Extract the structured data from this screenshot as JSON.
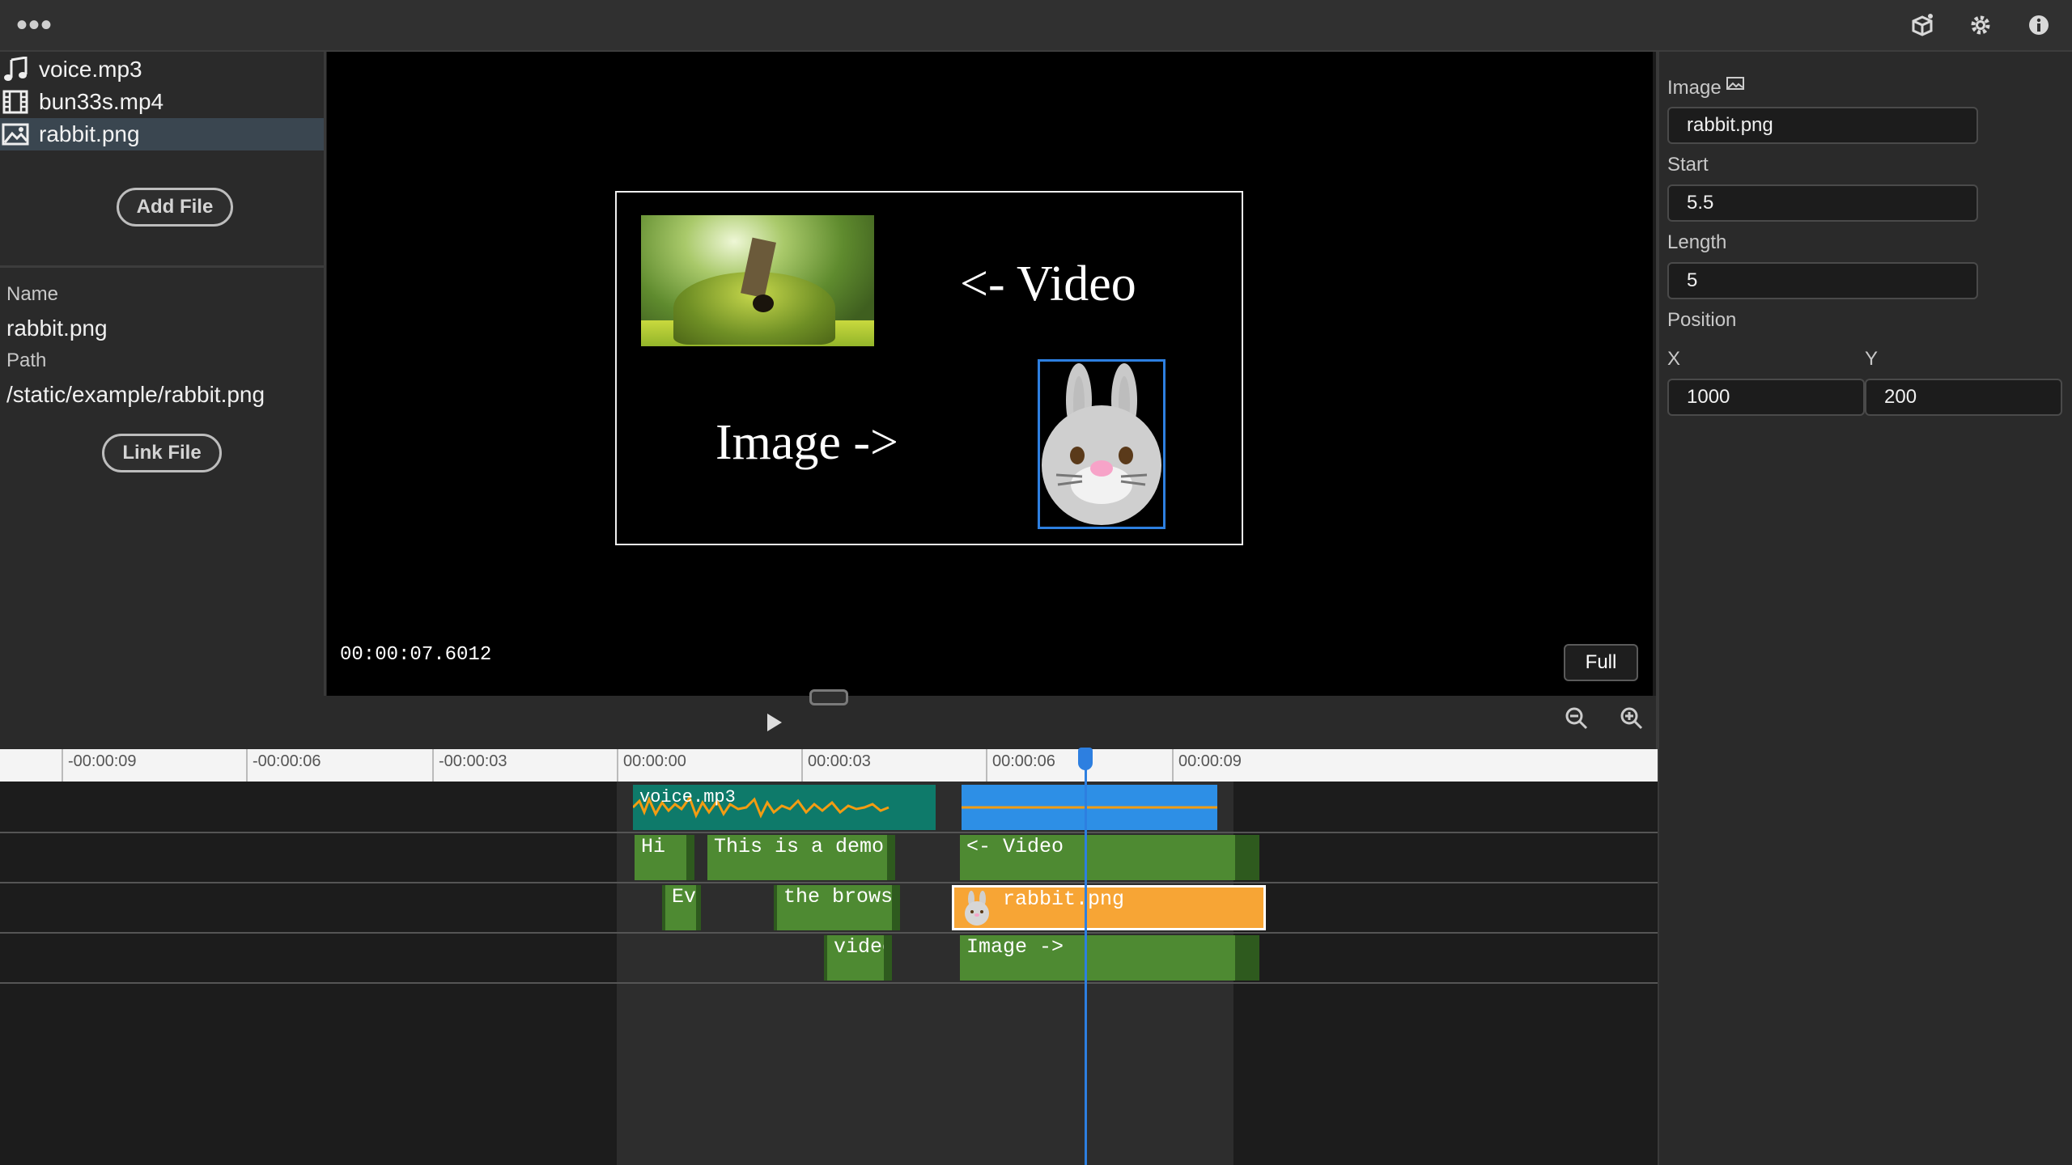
{
  "app": {
    "menu_icon": "more-dots-icon",
    "top_icons": [
      "cube-sparkle-icon",
      "gear-icon",
      "info-icon"
    ]
  },
  "files": [
    {
      "name": "voice.mp3",
      "icon": "music-note-icon"
    },
    {
      "name": "bun33s.mp4",
      "icon": "film-icon"
    },
    {
      "name": "rabbit.png",
      "icon": "image-icon",
      "selected": true
    }
  ],
  "file_actions": {
    "add": "Add File",
    "link": "Link File"
  },
  "selected_file": {
    "name_label": "Name",
    "name": "rabbit.png",
    "path_label": "Path",
    "path": "/static/example/rabbit.png"
  },
  "preview": {
    "video_label": "<- Video",
    "image_label": "Image ->",
    "timecode": "00:00:07.6012",
    "full_button": "Full"
  },
  "properties": {
    "image_label": "Image",
    "image_value": "rabbit.png",
    "start_label": "Start",
    "start_value": "5.5",
    "length_label": "Length",
    "length_value": "5",
    "position_label": "Position",
    "x_label": "X",
    "x_value": "1000",
    "y_label": "Y",
    "y_value": "200"
  },
  "timeline": {
    "ticks": [
      "-00:00:09",
      "-00:00:06",
      "-00:00:03",
      "00:00:00",
      "00:00:03",
      "00:00:06",
      "00:00:09"
    ],
    "clips": {
      "audio1": "voice.mp3",
      "t1a": "Hi",
      "t1b": "This is a demo o",
      "t1c": "<- Video",
      "t2a": "Eve",
      "t2b": "the browser",
      "t2c": "rabbit.png",
      "t3a": "video",
      "t3b": "Image ->"
    }
  },
  "colors": {
    "accent": "#2d7fe0",
    "text_clip": "#4e8a32",
    "audio_clip": "#0e7a6a",
    "image_clip": "#f7a535",
    "waveform": "#f39c12"
  }
}
